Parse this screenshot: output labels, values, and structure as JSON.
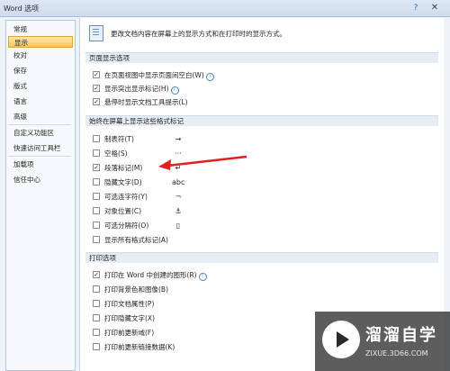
{
  "window": {
    "title": "Word 选项",
    "help_glyph": "?",
    "close_glyph": "✕"
  },
  "nav": {
    "items": [
      {
        "label": "常规"
      },
      {
        "label": "显示",
        "selected": true
      },
      {
        "label": "校对"
      },
      {
        "label": "保存"
      },
      {
        "label": "版式"
      },
      {
        "label": "语言"
      },
      {
        "label": "高级"
      },
      {
        "label": "自定义功能区"
      },
      {
        "label": "快速访问工具栏"
      },
      {
        "label": "加载项"
      },
      {
        "label": "信任中心"
      }
    ]
  },
  "intro": {
    "text": "更改文档内容在屏幕上的显示方式和在打印时的显示方式。"
  },
  "page_display": {
    "header": "页面显示选项",
    "options": [
      {
        "label": "在页面视图中显示页面间空白(W)",
        "checked": true,
        "info": true
      },
      {
        "label": "显示突出显示标记(H)",
        "checked": true,
        "info": true
      },
      {
        "label": "悬停时显示文档工具提示(L)",
        "checked": true,
        "info": false
      }
    ]
  },
  "format_marks": {
    "header": "始终在屏幕上显示这些格式标记",
    "options": [
      {
        "label": "制表符(T)",
        "checked": false,
        "mark": "→"
      },
      {
        "label": "空格(S)",
        "checked": false,
        "mark": "···"
      },
      {
        "label": "段落标记(M)",
        "checked": true,
        "mark": "↵"
      },
      {
        "label": "隐藏文字(D)",
        "checked": false,
        "mark": "abc"
      },
      {
        "label": "可选连字符(Y)",
        "checked": false,
        "mark": "¬"
      },
      {
        "label": "对象位置(C)",
        "checked": false,
        "mark": "⚓"
      },
      {
        "label": "可选分隔符(O)",
        "checked": false,
        "mark": "▯"
      },
      {
        "label": "显示所有格式标记(A)",
        "checked": false,
        "mark": ""
      }
    ]
  },
  "print": {
    "header": "打印选项",
    "options": [
      {
        "label": "打印在 Word 中创建的图形(R)",
        "checked": true,
        "info": true
      },
      {
        "label": "打印背景色和图像(B)",
        "checked": false,
        "info": false
      },
      {
        "label": "打印文档属性(P)",
        "checked": false,
        "info": false
      },
      {
        "label": "打印隐藏文字(X)",
        "checked": false,
        "info": false
      },
      {
        "label": "打印前更新域(F)",
        "checked": false,
        "info": false
      },
      {
        "label": "打印前更新链接数据(K)",
        "checked": false,
        "info": false
      }
    ]
  },
  "annotation": {
    "arrow_color": "#e02020"
  },
  "watermark": {
    "title": "溜溜自学",
    "subtitle": "ZIXUE.3D66.COM"
  }
}
